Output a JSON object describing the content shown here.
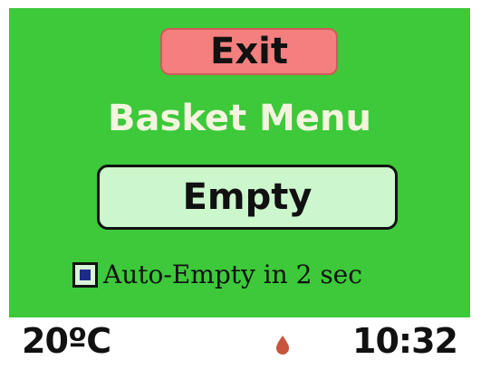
{
  "menu": {
    "exit_label": "Exit",
    "title": "Basket Menu",
    "empty_label": "Empty",
    "auto_empty": {
      "checked": true,
      "label": "Auto-Empty in 2 sec"
    }
  },
  "status_bar": {
    "temperature": "20ºC",
    "time": "10:32",
    "indicator_icon": "droplet-icon"
  },
  "colors": {
    "background": "#3dc93a",
    "exit_button": "#f37f7f",
    "empty_button": "#ccf6cc",
    "title_text": "#f4f4df",
    "status_bar": "#ffffff",
    "indicator": "#c8553d"
  }
}
